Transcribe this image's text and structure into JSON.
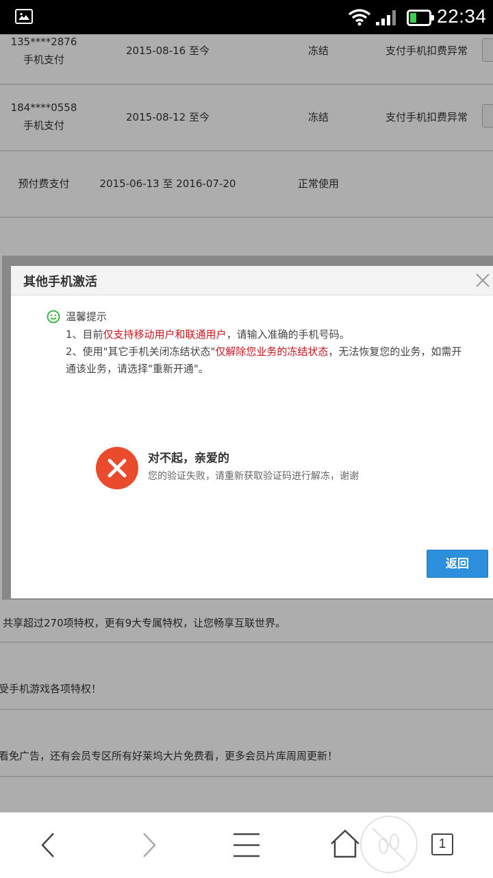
{
  "status_bar": {
    "time": "22:34"
  },
  "table": {
    "rows": [
      {
        "number": "135****2876",
        "type": "手机支付",
        "period": "2015-08-16 至今",
        "status": "冻结",
        "reason": "支付手机扣费异常"
      },
      {
        "number": "184****0558",
        "type": "手机支付",
        "period": "2015-08-12 至今",
        "status": "冻结",
        "reason": "支付手机扣费异常"
      },
      {
        "number": "",
        "type": "预付费支付",
        "period": "2015-06-13 至 2016-07-20",
        "status": "正常使用",
        "reason": ""
      }
    ]
  },
  "features": [
    "共享超过270项特权，更有9大专属特权，让您畅享互联世界。",
    "受手机游戏各项特权！",
    "看免广告，还有会员专区所有好莱坞大片免费看，更多会员片库周周更新！"
  ],
  "modal": {
    "title": "其他手机激活",
    "tips_title": "温馨提示",
    "tip1_prefix": "1、目前",
    "tip1_highlight": "仅支持移动用户和联通用户",
    "tip1_suffix": "，请输入准确的手机号码。",
    "tip2_prefix": "2、使用\"其它手机关闭冻结状态\"",
    "tip2_highlight": "仅解除您业务的冻结状态",
    "tip2_suffix": "，无法恢复您的业务，如需开通该业务，请选择\"重新开通\"。",
    "error_title": "对不起，亲爱的",
    "error_desc": "您的验证失败，请重新获取验证码进行解冻，谢谢",
    "back_label": "返回"
  },
  "bottom_nav": {
    "tab_count": "1"
  },
  "colors": {
    "highlight": "#c8161d",
    "button": "#2d8fdc",
    "error": "#ea4b2d",
    "smile": "#3db84a"
  }
}
